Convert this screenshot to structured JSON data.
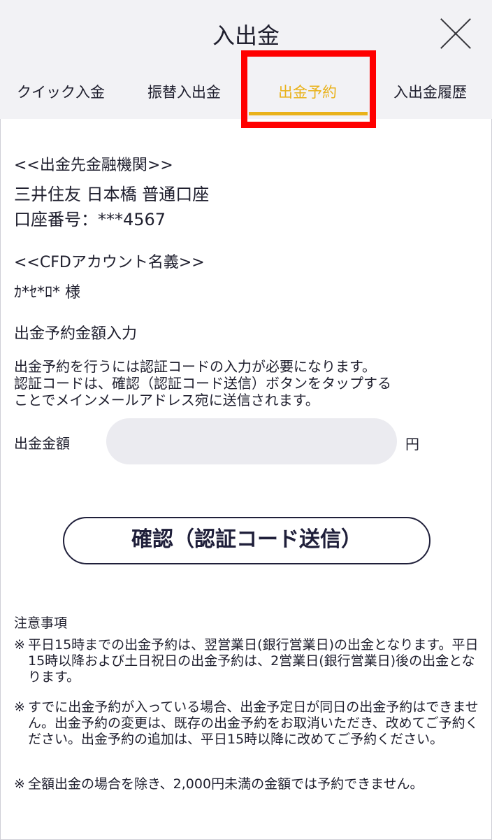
{
  "header": {
    "title": "入出金",
    "close_icon": "close-icon"
  },
  "tabs": [
    {
      "label": "クイック入金",
      "active": false
    },
    {
      "label": "振替入出金",
      "active": false
    },
    {
      "label": "出金予約",
      "active": true
    },
    {
      "label": "入出金履歴",
      "active": false
    }
  ],
  "colors": {
    "accent": "#e9b21b",
    "highlight": "#ff0000",
    "header_bg": "#f2f2f5",
    "input_bg": "#ebebf0",
    "text": "#1f1f2e"
  },
  "bank": {
    "heading": "<<出金先金融機関>>",
    "name": "三井住友 日本橋 普通口座",
    "account_number": "口座番号：***4567"
  },
  "account": {
    "heading": "<<CFDアカウント名義>>",
    "holder": "ｶ*ｾ*ﾛ* 様"
  },
  "reservation": {
    "heading": "出金予約金額入力",
    "description_lines": [
      "出金予約を行うには認証コードの入力が必要になります。",
      "認証コードは、確認（認証コード送信）ボタンをタップする",
      "ことでメインメールアドレス宛に送信されます。"
    ],
    "amount_label": "出金金額",
    "amount_value": "",
    "amount_placeholder": "",
    "currency": "円",
    "confirm_button": "確認（認証コード送信）"
  },
  "notes": {
    "heading": "注意事項",
    "mark": "※",
    "items": [
      "平日15時までの出金予約は、翌営業日(銀行営業日)の出金となります。平日15時以降および土日祝日の出金予約は、2営業日(銀行営業日)後の出金となります。",
      "すでに出金予約が入っている場合、出金予定日が同日の出金予約はできません。出金予約の変更は、既存の出金予約をお取消いただき、改めてご予約ください。出金予約の追加は、平日15時以降に改めてご予約ください。",
      "全額出金の場合を除き、2,000円未満の金額では予約できません。"
    ]
  }
}
